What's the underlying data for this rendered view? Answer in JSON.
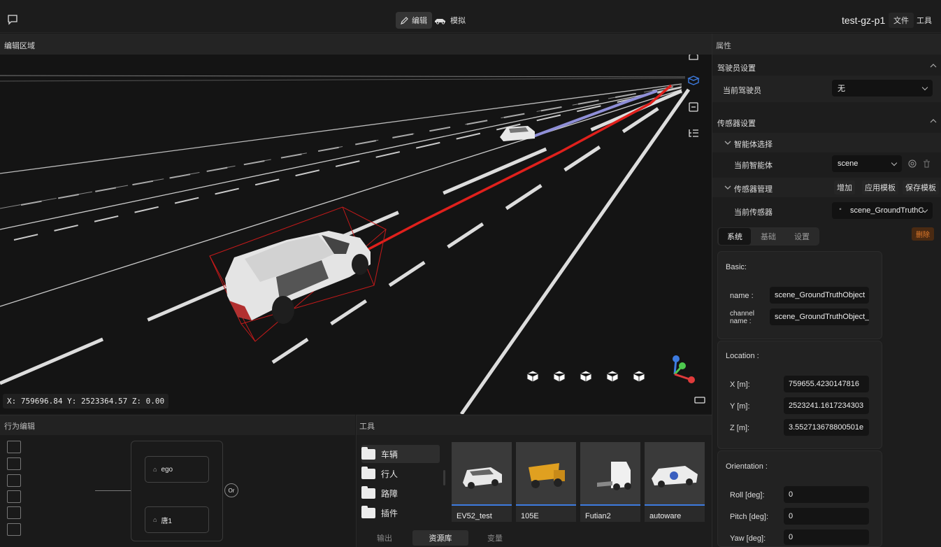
{
  "topbar": {
    "mode_edit": "编辑",
    "mode_sim": "模拟",
    "project": "test-gz-p1",
    "menu_file": "文件",
    "menu_tools": "工具"
  },
  "editor": {
    "title": "编辑区域",
    "coords": "X: 759696.84 Y: 2523364.57 Z: 0.00"
  },
  "behavior": {
    "title": "行为编辑",
    "node_ego": "ego",
    "node_2": "唐1",
    "or_label": "Or"
  },
  "tools": {
    "title": "工具",
    "folders": [
      "车辆",
      "行人",
      "路障",
      "插件"
    ],
    "assets": [
      "EV52_test",
      "105E",
      "Futian2",
      "autoware"
    ],
    "tabs": [
      "输出",
      "资源库",
      "变量"
    ]
  },
  "right": {
    "title": "属性",
    "driver_section": "驾驶员设置",
    "driver_label": "当前驾驶员",
    "driver_value": "无",
    "sensor_section": "传感器设置",
    "agent_group": "智能体选择",
    "agent_label": "当前智能体",
    "agent_value": "scene",
    "sensor_group": "传感器管理",
    "btn_add": "增加",
    "btn_apply": "应用模板",
    "btn_save": "保存模板",
    "sensor_label": "当前传感器",
    "sensor_value": "scene_GroundTruthC",
    "tabs": [
      "系统",
      "基础",
      "设置"
    ],
    "delete": "删除",
    "basic_title": "Basic:",
    "name_label": "name :",
    "name_value": "scene_GroundTruthObject",
    "channel_label_1": "channel",
    "channel_label_2": "name :",
    "channel_value": "scene_GroundTruthObject_c",
    "location_title": "Location :",
    "x_label": "X [m]:",
    "x_value": "759655.4230147816",
    "y_label": "Y [m]:",
    "y_value": "2523241.1617234303",
    "z_label": "Z [m]:",
    "z_value": "3.552713678800501e",
    "orient_title": "Orientation :",
    "roll_label": "Roll [deg]:",
    "roll_value": "0",
    "pitch_label": "Pitch [deg]:",
    "pitch_value": "0",
    "yaw_label": "Yaw [deg]:",
    "yaw_value": "0"
  },
  "colors": {
    "accent": "#3d7be0",
    "trajectory": "#e0201c",
    "delete": "#e07a2b"
  }
}
